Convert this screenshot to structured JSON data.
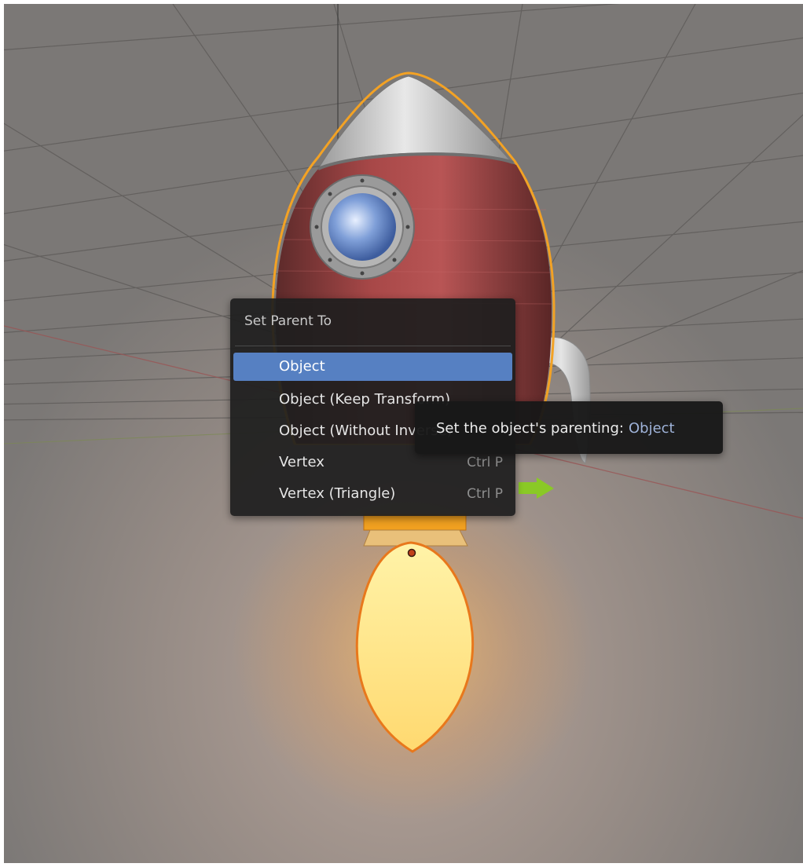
{
  "viewport": {
    "background_color": "#7d7a78",
    "selection_outline_color": "#f0a020",
    "gizmo_arrow_color": "#8ac926"
  },
  "menu": {
    "title": "Set Parent To",
    "items": [
      {
        "label": "Object",
        "shortcut": "",
        "active": true
      },
      {
        "label": "Object (Keep Transform)",
        "shortcut": "",
        "active": false
      },
      {
        "label": "Object (Without Inverse)",
        "shortcut": "",
        "active": false
      },
      {
        "label": "Vertex",
        "shortcut": "Ctrl P",
        "active": false
      },
      {
        "label": "Vertex (Triangle)",
        "shortcut": "Ctrl P",
        "active": false
      }
    ],
    "highlight_color": "#5680c2"
  },
  "tooltip": {
    "text": "Set the object's parenting:",
    "value": "Object"
  }
}
